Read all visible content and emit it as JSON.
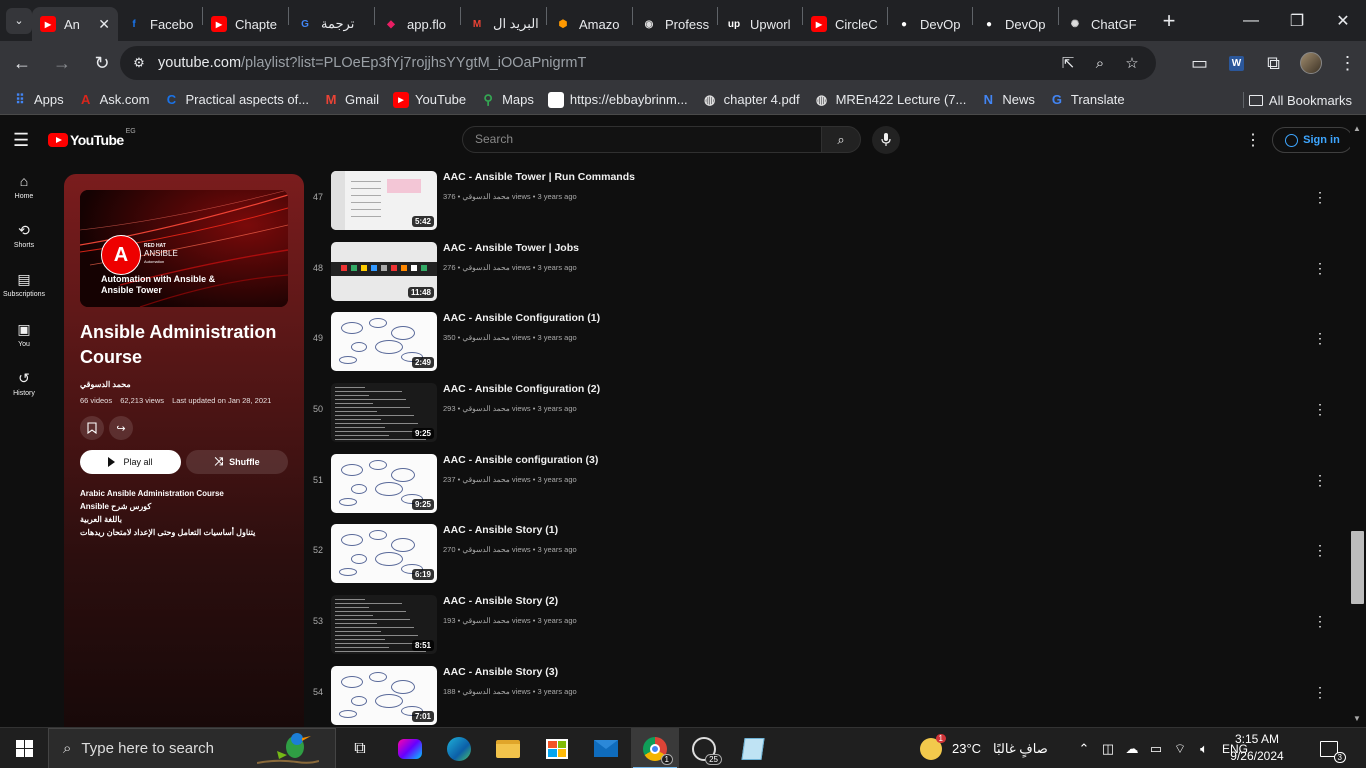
{
  "browser": {
    "tabs": [
      {
        "label": "An",
        "favicon_color": "#ff0000",
        "favicon": "youtube-icon",
        "active": true
      },
      {
        "label": "Facebo",
        "favicon_color": "#1877f2",
        "favicon": "facebook-icon"
      },
      {
        "label": "Chapte",
        "favicon_color": "#ff0000",
        "favicon": "youtube-icon"
      },
      {
        "label": "ترجمة",
        "favicon_color": "#4285f4",
        "favicon": "translate-icon"
      },
      {
        "label": "app.flo",
        "favicon_color": "#e91e63",
        "favicon": "flowchart-icon"
      },
      {
        "label": "البريد ال",
        "favicon_color": "#ea4335",
        "favicon": "gmail-icon"
      },
      {
        "label": "Amazo",
        "favicon_color": "#ff9900",
        "favicon": "aws-icon"
      },
      {
        "label": "Profess",
        "favicon_color": "#dddddd",
        "favicon": "mask-icon"
      },
      {
        "label": "Upworl",
        "favicon_color": "#ffffff",
        "favicon": "upwork-icon"
      },
      {
        "label": "CircleC",
        "favicon_color": "#ff0000",
        "favicon": "youtube-icon"
      },
      {
        "label": "DevOp",
        "favicon_color": "#ffffff",
        "favicon": "github-icon"
      },
      {
        "label": "DevOp",
        "favicon_color": "#ffffff",
        "favicon": "github-icon"
      },
      {
        "label": "ChatGF",
        "favicon_color": "#dddddd",
        "favicon": "openai-icon"
      }
    ],
    "url_host": "youtube.com",
    "url_path": "/playlist?list=PLOeEp3fYj7rojjhsYYgtM_iOOaPnigrmT",
    "bookmarks": [
      {
        "label": "Apps",
        "icon": "apps-grid-icon",
        "color": "#4285f4"
      },
      {
        "label": "Ask.com",
        "icon": "ask-icon",
        "color": "#d9261c"
      },
      {
        "label": "Practical aspects of...",
        "icon": "circle-c-icon",
        "color": "#1a73e8"
      },
      {
        "label": "Gmail",
        "icon": "gmail-icon",
        "color": "#ea4335"
      },
      {
        "label": "YouTube",
        "icon": "youtube-icon",
        "color": "#ff0000"
      },
      {
        "label": "Maps",
        "icon": "maps-pin-icon",
        "color": "#34a853"
      },
      {
        "label": "https://ebbaybrinm...",
        "icon": "blank-page-icon",
        "color": "#ffffff"
      },
      {
        "label": "chapter 4.pdf",
        "icon": "globe-icon",
        "color": "#dddddd"
      },
      {
        "label": "MREn422 Lecture (7...",
        "icon": "globe-icon",
        "color": "#dddddd"
      },
      {
        "label": "News",
        "icon": "news-icon",
        "color": "#4285f4"
      },
      {
        "label": "Translate",
        "icon": "translate-icon",
        "color": "#4285f4"
      }
    ],
    "all_bookmarks": "All Bookmarks"
  },
  "youtube": {
    "logo_text": "YouTube",
    "region": "EG",
    "search_placeholder": "Search",
    "sign_in": "Sign in",
    "guide": [
      {
        "label": "Home",
        "icon": "home-icon"
      },
      {
        "label": "Shorts",
        "icon": "shorts-icon"
      },
      {
        "label": "Subscriptions",
        "icon": "subscriptions-icon"
      },
      {
        "label": "You",
        "icon": "you-icon"
      },
      {
        "label": "History",
        "icon": "history-icon"
      }
    ]
  },
  "playlist": {
    "thumb_brand_top": "RED HAT",
    "thumb_brand": "ANSIBLE",
    "thumb_brand_sub": "Automation",
    "thumb_caption_1": "Automation with Ansible &",
    "thumb_caption_2": "Ansible Tower",
    "title": "Ansible Administration Course",
    "owner": "محمد الدسوقي",
    "videos": "66 videos",
    "views": "62,213 views",
    "updated": "Last updated on Jan 28, 2021",
    "play_all": "Play all",
    "shuffle": "Shuffle",
    "description": [
      "Arabic Ansible Administration Course",
      "كورس شرح Ansible",
      "باللغة العربية",
      "يتناول أساسيات التعامل وحتى الإعداد لامتحان ريدهات"
    ]
  },
  "videos": [
    {
      "index": "47",
      "title": "AAC - Ansible Tower | Run Commands",
      "channel": "محمد الدسوقي",
      "views": "376 views",
      "age": "3 years ago",
      "duration": "5:42",
      "thumb": "screen-light"
    },
    {
      "index": "48",
      "title": "AAC - Ansible Tower | Jobs",
      "channel": "محمد الدسوقي",
      "views": "276 views",
      "age": "3 years ago",
      "duration": "11:48",
      "thumb": "taskbar"
    },
    {
      "index": "49",
      "title": "AAC - Ansible Configuration (1)",
      "channel": "محمد الدسوقي",
      "views": "350 views",
      "age": "3 years ago",
      "duration": "2:49",
      "thumb": "whiteboard"
    },
    {
      "index": "50",
      "title": "AAC - Ansible Configuration (2)",
      "channel": "محمد الدسوقي",
      "views": "293 views",
      "age": "3 years ago",
      "duration": "9:25",
      "thumb": "terminal"
    },
    {
      "index": "51",
      "title": "AAC - Ansible configuration (3)",
      "channel": "محمد الدسوقي",
      "views": "237 views",
      "age": "3 years ago",
      "duration": "9:25",
      "thumb": "whiteboard"
    },
    {
      "index": "52",
      "title": "AAC - Ansible Story (1)",
      "channel": "محمد الدسوقي",
      "views": "270 views",
      "age": "3 years ago",
      "duration": "6:19",
      "thumb": "whiteboard"
    },
    {
      "index": "53",
      "title": "AAC - Ansible Story (2)",
      "channel": "محمد الدسوقي",
      "views": "193 views",
      "age": "3 years ago",
      "duration": "8:51",
      "thumb": "terminal"
    },
    {
      "index": "54",
      "title": "AAC - Ansible Story (3)",
      "channel": "محمد الدسوقي",
      "views": "188 views",
      "age": "3 years ago",
      "duration": "7:01",
      "thumb": "whiteboard"
    }
  ],
  "taskbar": {
    "search_placeholder": "Type here to search",
    "chrome_badge": "1",
    "whatsapp_badge": "25",
    "weather_temp": "23°C",
    "weather_text": "صافٍ غالبًا",
    "weather_badge": "1",
    "language": "ENG",
    "time": "3:15 AM",
    "date": "9/26/2024",
    "notifications": "3"
  }
}
